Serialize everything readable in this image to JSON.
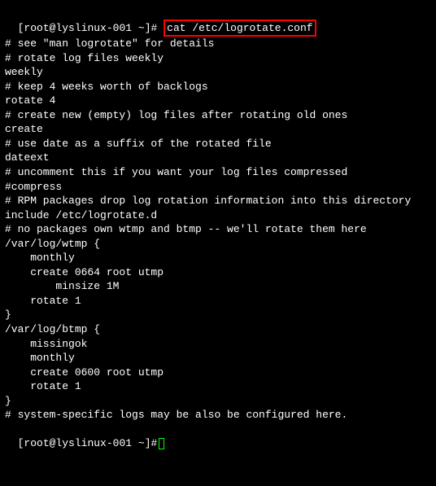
{
  "prompt": {
    "user": "root",
    "host": "lyslinux-001",
    "cwd": "~",
    "symbol": "#"
  },
  "command": "cat /etc/logrotate.conf",
  "lines": {
    "l0": "# see \"man logrotate\" for details",
    "l1": "# rotate log files weekly",
    "l2": "weekly",
    "l3": "",
    "l4": "# keep 4 weeks worth of backlogs",
    "l5": "rotate 4",
    "l6": "",
    "l7": "# create new (empty) log files after rotating old ones",
    "l8": "create",
    "l9": "",
    "l10": "# use date as a suffix of the rotated file",
    "l11": "dateext",
    "l12": "",
    "l13": "# uncomment this if you want your log files compressed",
    "l14": "#compress",
    "l15": "",
    "l16": "# RPM packages drop log rotation information into this directory",
    "l17": "include /etc/logrotate.d",
    "l18": "",
    "l19": "# no packages own wtmp and btmp -- we'll rotate them here",
    "l20": "/var/log/wtmp {",
    "l21": "    monthly",
    "l22": "    create 0664 root utmp",
    "l23": "        minsize 1M",
    "l24": "    rotate 1",
    "l25": "}",
    "l26": "",
    "l27": "/var/log/btmp {",
    "l28": "    missingok",
    "l29": "    monthly",
    "l30": "    create 0600 root utmp",
    "l31": "    rotate 1",
    "l32": "}",
    "l33": "",
    "l34": "# system-specific logs may be also be configured here."
  }
}
